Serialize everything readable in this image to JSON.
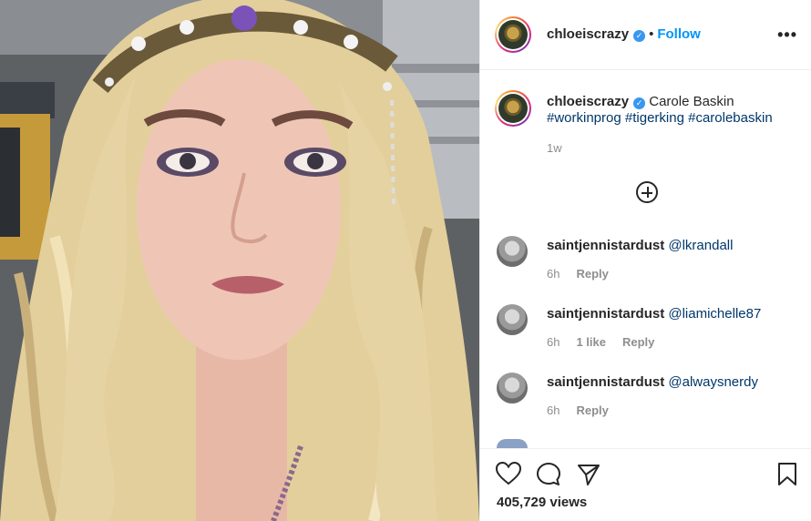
{
  "post": {
    "username": "chloeiscrazy",
    "follow_label": "Follow",
    "more_label": "•••",
    "verified_label": "✓",
    "separator": "•"
  },
  "caption": {
    "username": "chloeiscrazy",
    "text": "Carole Baskin",
    "hashtags": [
      "#workinprog",
      "#tigerking",
      "#carolebaskin"
    ],
    "time": "1w"
  },
  "comments": [
    {
      "user": "saintjennistardust",
      "mention": "@lkrandall",
      "time": "6h",
      "likes": "",
      "reply": "Reply"
    },
    {
      "user": "saintjennistardust",
      "mention": "@liamichelle87",
      "time": "6h",
      "likes": "1 like",
      "reply": "Reply"
    },
    {
      "user": "saintjennistardust",
      "mention": "@alwaysnerdy",
      "time": "6h",
      "likes": "",
      "reply": "Reply"
    }
  ],
  "footer": {
    "views": "405,729 views"
  },
  "colors": {
    "link": "#0095f6",
    "hashtag": "#00376b",
    "muted": "#8e8e8e",
    "verified": "#3897f0"
  }
}
